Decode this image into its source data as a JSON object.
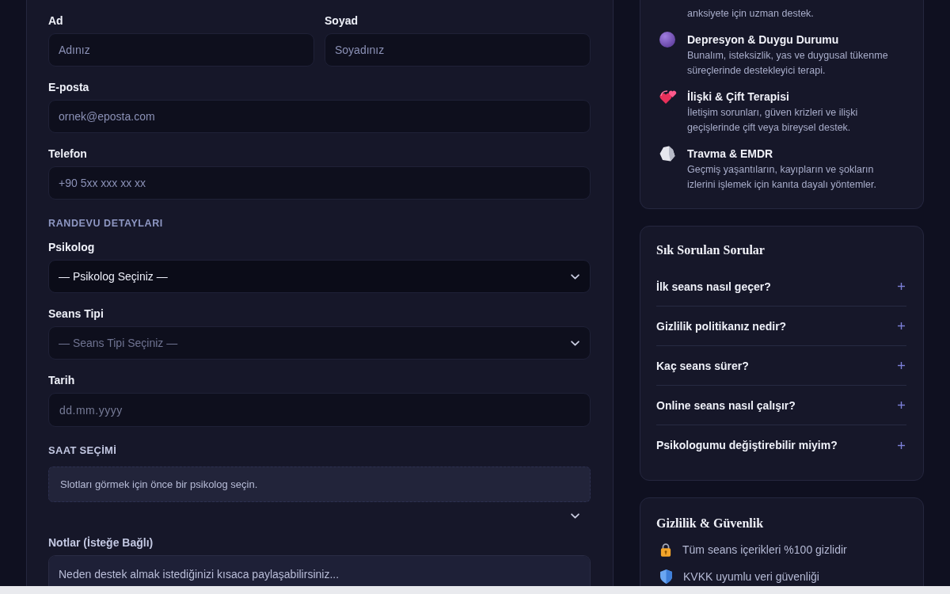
{
  "form": {
    "items": [
      {
        "kind": "pair",
        "fields": [
          {
            "label": "Ad",
            "placeholder": "Adınız"
          },
          {
            "label": "Soyad",
            "placeholder": "Soyadınız"
          }
        ]
      },
      {
        "kind": "input",
        "label": "E-posta",
        "placeholder": "ornek@eposta.com"
      },
      {
        "kind": "input",
        "label": "Telefon",
        "placeholder": "+90 5xx xxx xx xx"
      },
      {
        "kind": "heading",
        "text": "RANDEVU DETAYLARI"
      },
      {
        "kind": "select",
        "label": "Psikolog",
        "value": "— Psikolog Seçiniz —",
        "disabled": false
      },
      {
        "kind": "select",
        "label": "Seans Tipi",
        "value": "— Seans Tipi Seçiniz —",
        "disabled": true
      },
      {
        "kind": "date",
        "label": "Tarih",
        "placeholder": "dd.mm.yyyy"
      },
      {
        "kind": "slots",
        "label": "SAAT SEÇİMİ",
        "message": "Slotları görmek için önce bir psikolog seçin."
      },
      {
        "kind": "textarea",
        "label": "Notlar (İsteğe Bağlı)",
        "placeholder": "Neden destek almak istediğinizi kısaca paylaşabilirsiniz..."
      }
    ]
  },
  "topics": {
    "items": [
      {
        "description": "anksiyete için uzman destek."
      },
      {
        "title": "Depresyon & Duygu Durumu",
        "description": "Bunalım, isteksizlik, yas ve duygusal tükenme süreçlerinde destekleyici terapi."
      },
      {
        "title": "İlişki & Çift Terapisi",
        "description": "İletişim sorunları, güven krizleri ve ilişki geçişlerinde çift veya bireysel destek."
      },
      {
        "title": "Travma & EMDR",
        "description": "Geçmiş yaşantıların, kayıpların ve şokların izlerini işlemek için kanıta dayalı yöntemler."
      }
    ]
  },
  "faq": {
    "title": "Sık Sorulan Sorular",
    "items": [
      {
        "question": "İlk seans nasıl geçer?",
        "expanded": false
      },
      {
        "question": "Gizlilik politikanız nedir?",
        "expanded": false
      },
      {
        "question": "Kaç seans sürer?",
        "expanded": false
      },
      {
        "question": "Online seans nasıl çalışır?",
        "expanded": false
      },
      {
        "question": "Psikologumu değiştirebilir miyim?",
        "expanded": false
      }
    ]
  },
  "privacy": {
    "title": "Gizlilik & Güvenlik",
    "items": [
      "Tüm seans içerikleri %100 gizlidir",
      "KVKK uyumlu veri güvenliği"
    ]
  }
}
